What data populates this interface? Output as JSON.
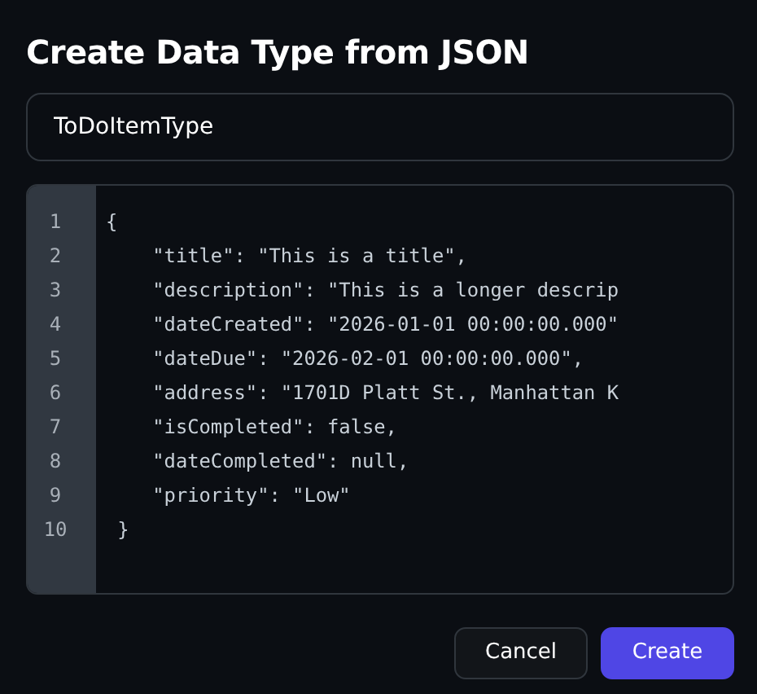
{
  "dialog": {
    "title": "Create Data Type from JSON"
  },
  "name_field": {
    "value": "ToDoItemType"
  },
  "editor": {
    "lines": [
      {
        "number": "1",
        "code": "{"
      },
      {
        "number": "2",
        "code": "    \"title\": \"This is a title\","
      },
      {
        "number": "3",
        "code": "    \"description\": \"This is a longer descrip"
      },
      {
        "number": "4",
        "code": "    \"dateCreated\": \"2026-01-01 00:00:00.000\""
      },
      {
        "number": "5",
        "code": "    \"dateDue\": \"2026-02-01 00:00:00.000\","
      },
      {
        "number": "6",
        "code": "    \"address\": \"1701D Platt St., Manhattan K"
      },
      {
        "number": "7",
        "code": "    \"isCompleted\": false,"
      },
      {
        "number": "8",
        "code": "    \"dateCompleted\": null,"
      },
      {
        "number": "9",
        "code": "    \"priority\": \"Low\""
      },
      {
        "number": "10",
        "code": " }"
      }
    ]
  },
  "buttons": [
    {
      "label": "Cancel",
      "kind": "secondary"
    },
    {
      "label": "Create",
      "kind": "primary"
    }
  ]
}
